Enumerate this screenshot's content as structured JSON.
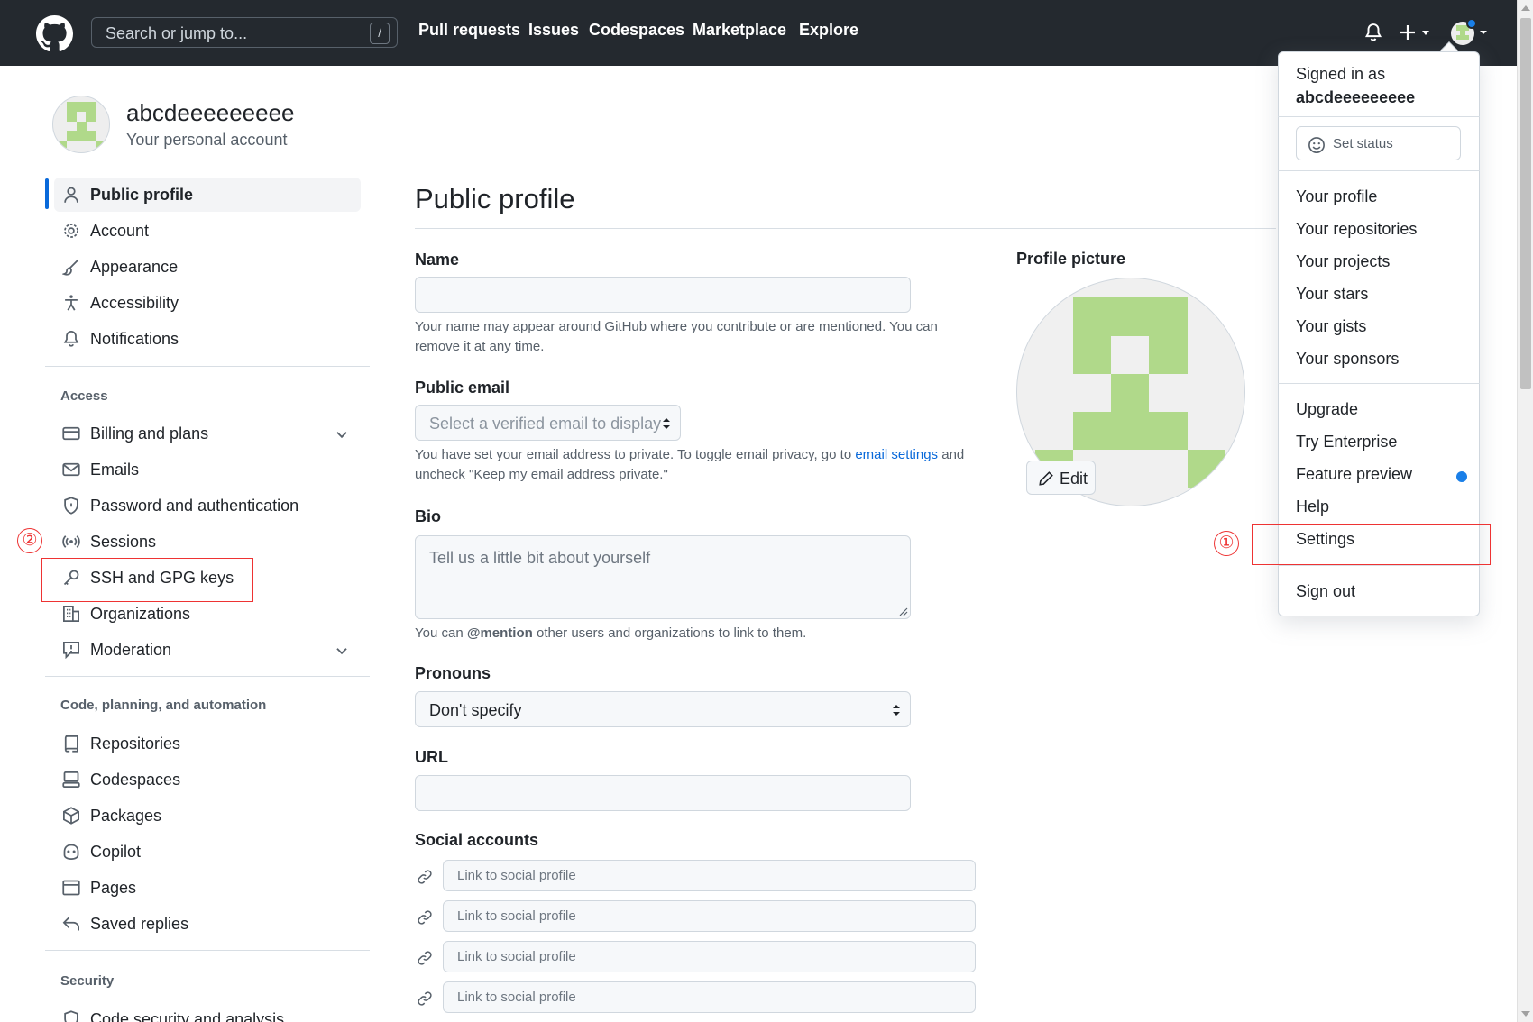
{
  "header": {
    "search_placeholder": "Search or jump to...",
    "search_shortcut": "/",
    "nav": [
      "Pull requests",
      "Issues",
      "Codespaces",
      "Marketplace",
      "Explore"
    ]
  },
  "account": {
    "username": "abcdeeeeeeeee",
    "subtitle": "Your personal account"
  },
  "sidebar": {
    "items_top": [
      {
        "label": "Public profile",
        "icon": "person-icon",
        "active": true
      },
      {
        "label": "Account",
        "icon": "gear-icon"
      },
      {
        "label": "Appearance",
        "icon": "paintbrush-icon"
      },
      {
        "label": "Accessibility",
        "icon": "accessibility-icon"
      },
      {
        "label": "Notifications",
        "icon": "bell-icon"
      }
    ],
    "access_heading": "Access",
    "access_items": [
      {
        "label": "Billing and plans",
        "icon": "credit-card-icon",
        "expandable": true
      },
      {
        "label": "Emails",
        "icon": "mail-icon"
      },
      {
        "label": "Password and authentication",
        "icon": "shield-icon"
      },
      {
        "label": "Sessions",
        "icon": "broadcast-icon"
      },
      {
        "label": "SSH and GPG keys",
        "icon": "key-icon"
      },
      {
        "label": "Organizations",
        "icon": "organization-icon"
      },
      {
        "label": "Moderation",
        "icon": "report-icon",
        "expandable": true
      }
    ],
    "code_heading": "Code, planning, and automation",
    "code_items": [
      {
        "label": "Repositories",
        "icon": "repo-icon"
      },
      {
        "label": "Codespaces",
        "icon": "codespaces-icon"
      },
      {
        "label": "Packages",
        "icon": "package-icon"
      },
      {
        "label": "Copilot",
        "icon": "copilot-icon"
      },
      {
        "label": "Pages",
        "icon": "browser-icon"
      },
      {
        "label": "Saved replies",
        "icon": "reply-icon"
      }
    ],
    "security_heading": "Security",
    "security_items": [
      {
        "label": "Code security and analysis",
        "icon": "codescan-icon"
      }
    ]
  },
  "main": {
    "title": "Public profile",
    "name_label": "Name",
    "name_value": "",
    "name_help": "Your name may appear around GitHub where you contribute or are mentioned. You can remove it at any time.",
    "email_label": "Public email",
    "email_select": "Select a verified email to display",
    "email_help_pre": "You have set your email address to private. To toggle email privacy, go to",
    "email_help_link": "email settings",
    "email_help_post": "and uncheck \"Keep my email address private.\"",
    "bio_label": "Bio",
    "bio_placeholder": "Tell us a little bit about yourself",
    "bio_help_pre": "You can",
    "bio_help_mention": "@mention",
    "bio_help_post": "other users and organizations to link to them.",
    "pronouns_label": "Pronouns",
    "pronouns_value": "Don't specify",
    "url_label": "URL",
    "url_value": "",
    "social_label": "Social accounts",
    "social_placeholders": [
      "Link to social profile",
      "Link to social profile",
      "Link to social profile",
      "Link to social profile"
    ],
    "profile_picture_label": "Profile picture",
    "edit_label": "Edit"
  },
  "dropdown": {
    "signed_in_as": "Signed in as",
    "username": "abcdeeeeeeeee",
    "set_status": "Set status",
    "group1": [
      "Your profile",
      "Your repositories",
      "Your projects",
      "Your stars",
      "Your gists",
      "Your sponsors"
    ],
    "group2": [
      "Upgrade",
      "Try Enterprise",
      "Feature preview",
      "Help",
      "Settings"
    ],
    "sign_out": "Sign out"
  },
  "annotations": [
    "①",
    "②"
  ],
  "colors": {
    "header_bg": "#24292f",
    "accent": "#0969da",
    "identicon": "#b0d98a",
    "annotation": "#ee3333"
  }
}
